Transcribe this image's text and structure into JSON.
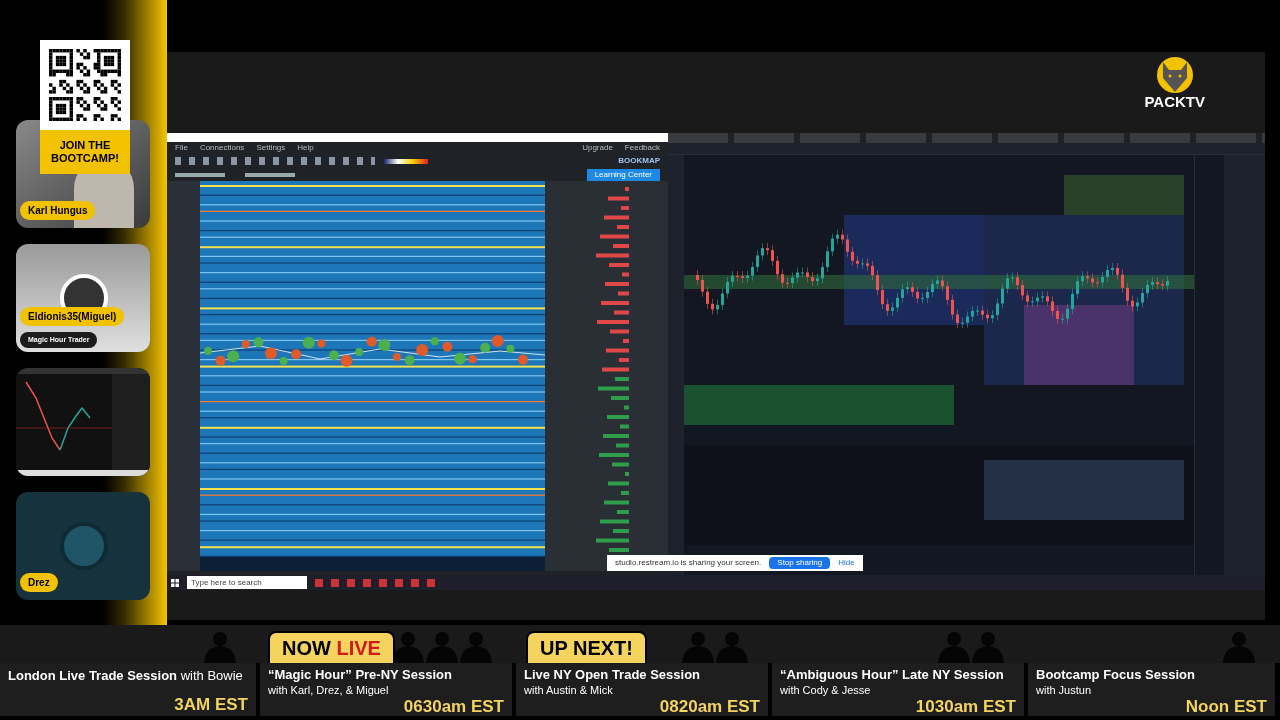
{
  "qr_promo": {
    "text": "JOIN THE BOOTCAMP!"
  },
  "webcams": [
    {
      "kind": "camera",
      "name": "Karl Hungus"
    },
    {
      "kind": "avatar",
      "name": "Eldionis35(Miguel)",
      "role": "Magic Hour Trader"
    },
    {
      "kind": "screen"
    },
    {
      "kind": "avatar",
      "name": "Drez"
    }
  ],
  "logo": {
    "text": "PACKTV"
  },
  "shared_screen": {
    "bookmap": {
      "menu": [
        "File",
        "Connections",
        "Settings",
        "Help"
      ],
      "right_menu": [
        "Upgrade",
        "Feedback"
      ],
      "brand": "BOOKMAP",
      "button": "Learning Center"
    },
    "share_notice": {
      "text": "studio.restream.io is sharing your screen.",
      "button": "Stop sharing",
      "link": "Hide"
    },
    "taskbar": {
      "search_placeholder": "Type here to search"
    }
  },
  "schedule": [
    {
      "title": "London Live Trade Session",
      "host": "with Bowie",
      "host_inline": true,
      "time": "3AM EST"
    },
    {
      "title": "“Magic Hour” Pre-NY Session",
      "host": "with Karl, Drez, & Miguel",
      "host_inline": false,
      "time": "0630am EST",
      "banner": {
        "text": "NOW",
        "accent": "LIVE"
      }
    },
    {
      "title": "Live NY Open Trade Session",
      "host": "with Austin & Mick",
      "host_inline": false,
      "time": "0820am EST",
      "banner": {
        "text": "UP NEXT!"
      }
    },
    {
      "title": "“Ambiguous Hour” Late NY Session",
      "host": "with Cody & Jesse",
      "host_inline": false,
      "time": "1030am EST"
    },
    {
      "title": "Bootcamp Focus Session",
      "host": "with Justun",
      "host_inline": false,
      "time": "Noon EST"
    }
  ]
}
